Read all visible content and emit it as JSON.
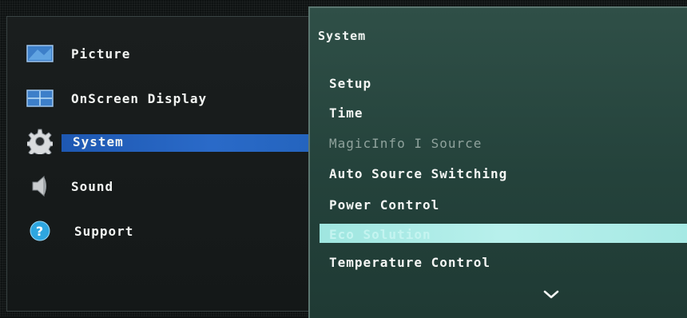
{
  "left_menu": {
    "items": [
      {
        "label": "Picture",
        "icon": "picture-icon"
      },
      {
        "label": "OnScreen Display",
        "icon": "onscreen-display-icon"
      },
      {
        "label": "System",
        "icon": "gear-icon",
        "selected": true
      },
      {
        "label": "Sound",
        "icon": "speaker-icon"
      },
      {
        "label": "Support",
        "icon": "help-icon"
      }
    ]
  },
  "right_menu": {
    "title": "System",
    "items": [
      {
        "label": "Setup"
      },
      {
        "label": "Time"
      },
      {
        "label": "MagicInfo I Source",
        "disabled": true
      },
      {
        "label": "Auto Source Switching"
      },
      {
        "label": "Power Control"
      },
      {
        "label": "Eco Solution",
        "highlighted": true
      },
      {
        "label": "Temperature Control"
      }
    ],
    "more_icon": "chevron-down-icon"
  },
  "colors": {
    "selected_bar": "#2464be",
    "highlight_bar": "#a6e9e4",
    "right_panel_bg": "#2f4f47"
  }
}
